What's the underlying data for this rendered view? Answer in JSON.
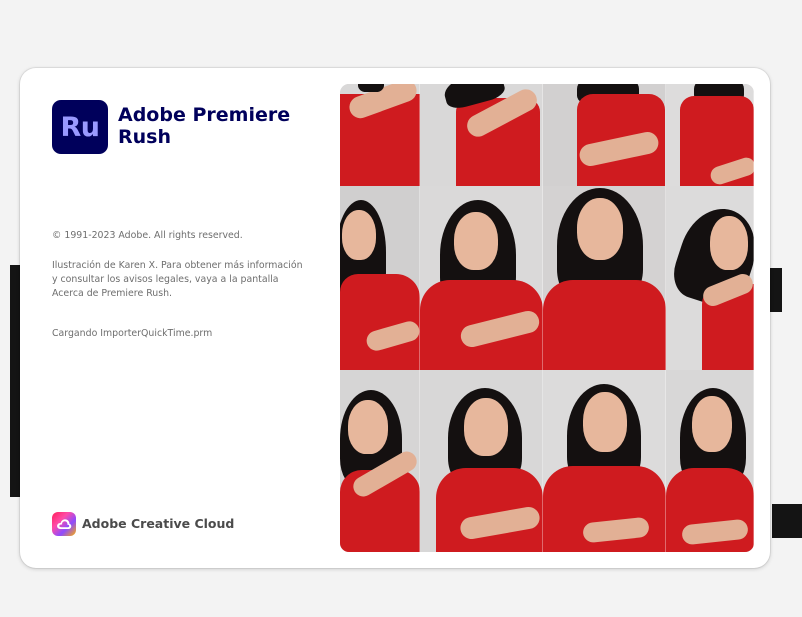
{
  "app": {
    "icon_text": "Ru",
    "name": "Adobe Premiere Rush"
  },
  "copyright": "© 1991-2023 Adobe. All rights reserved.",
  "illustration_credit": "Ilustración de Karen X. Para obtener más información y consultar los avisos legales, vaya a la pantalla Acerca de Premiere Rush.",
  "loading_status": "Cargando ImporterQuickTime.prm",
  "footer": {
    "brand": "Adobe Creative Cloud",
    "logo_icon": "creative-cloud-icon"
  },
  "colors": {
    "app_icon_bg": "#00005b",
    "app_icon_text": "#9999ff",
    "app_name": "#00005b",
    "shirt_red": "#cf1b1f"
  },
  "collage": {
    "description_icon": "photo-collage",
    "rows": 3,
    "columns": 4
  }
}
